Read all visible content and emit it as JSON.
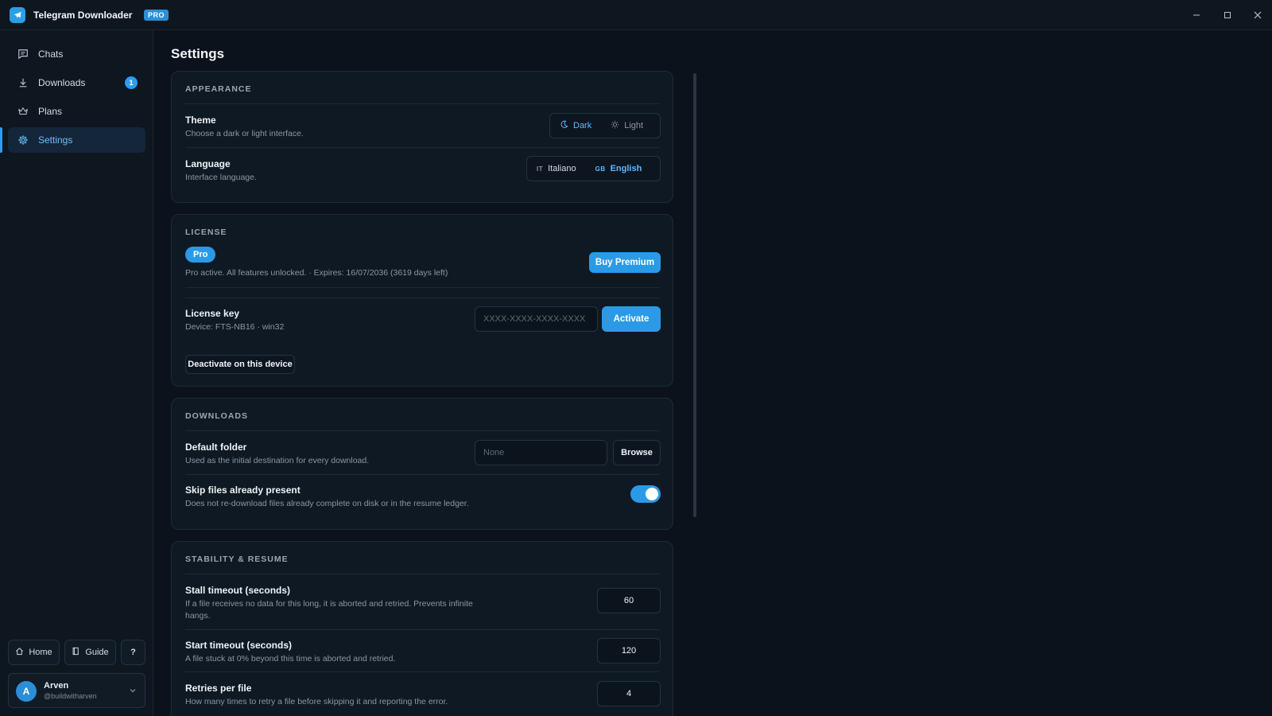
{
  "app": {
    "title": "Telegram Downloader",
    "badge": "PRO"
  },
  "window_controls": {
    "minimize": "–",
    "maximize": "▢",
    "close": "✕"
  },
  "sidebar": {
    "items": [
      {
        "label": "Chats",
        "icon": "chat-icon"
      },
      {
        "label": "Downloads",
        "icon": "download-icon",
        "count": "1"
      },
      {
        "label": "Plans",
        "icon": "crown-icon"
      },
      {
        "label": "Settings",
        "icon": "gear-icon",
        "active": true
      }
    ],
    "bottom": {
      "home": "Home",
      "guide": "Guide",
      "help": "?"
    },
    "user": {
      "initial": "A",
      "name": "Arven",
      "handle": "@buildwitharven"
    }
  },
  "page": {
    "title": "Settings"
  },
  "appearance": {
    "title": "APPEARANCE",
    "theme": {
      "label": "Theme",
      "desc": "Choose a dark or light interface.",
      "dark": "Dark",
      "light": "Light",
      "selected": "Dark"
    },
    "language": {
      "label": "Language",
      "desc": "Interface language.",
      "it_code": "IT",
      "it": "Italiano",
      "gb_code": "GB",
      "en": "English",
      "selected": "English"
    }
  },
  "license": {
    "title": "LICENSE",
    "plan": "Pro",
    "status": "Pro active. All features unlocked. · Expires: 16/07/2036 (3619 days left)",
    "buy": "Buy Premium",
    "key_label": "License key",
    "device": "Device: FTS-NB16 · win32",
    "key_placeholder": "XXXX-XXXX-XXXX-XXXX",
    "activate": "Activate",
    "deactivate": "Deactivate on this device"
  },
  "downloads": {
    "title": "DOWNLOADS",
    "folder": {
      "label": "Default folder",
      "desc": "Used as the initial destination for every download.",
      "placeholder": "None",
      "browse": "Browse"
    },
    "skip": {
      "label": "Skip files already present",
      "desc": "Does not re-download files already complete on disk or in the resume ledger.",
      "enabled": true
    }
  },
  "stability": {
    "title": "STABILITY & RESUME",
    "stall": {
      "label": "Stall timeout (seconds)",
      "desc": "If a file receives no data for this long, it is aborted and retried. Prevents infinite hangs.",
      "value": "60"
    },
    "start": {
      "label": "Start timeout (seconds)",
      "desc": "A file stuck at 0% beyond this time is aborted and retried.",
      "value": "120"
    },
    "retries": {
      "label": "Retries per file",
      "desc": "How many times to retry a file before skipping it and reporting the error.",
      "value": "4"
    }
  },
  "colors": {
    "accent": "#2b9ae6",
    "background": "#0b121b",
    "card": "#0f1923"
  }
}
